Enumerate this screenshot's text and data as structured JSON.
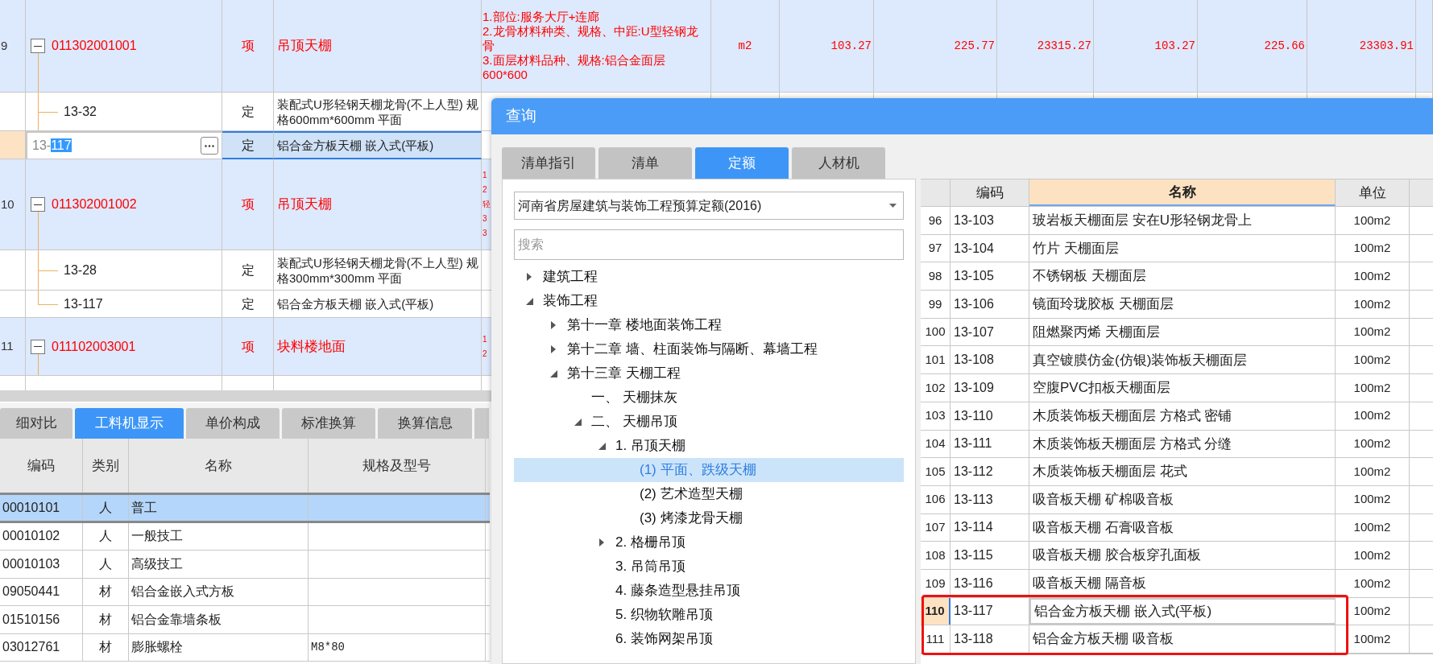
{
  "main_table": {
    "rows": [
      {
        "kind": "item",
        "number": "9",
        "code": "011302001001",
        "expanded": true,
        "type": "项",
        "name": "吊顶天棚",
        "features": [
          "1.部位:服务大厅+连廊",
          "2.龙骨材料种类、规格、中距:U型轻钢龙骨",
          "3.面层材料品种、规格:铝合金面层600*600"
        ],
        "unit": "m2",
        "values": [
          "103.27",
          "225.77",
          "23315.27",
          "103.27",
          "225.66",
          "23303.91"
        ],
        "selected": false
      },
      {
        "kind": "quota",
        "code": "13-32",
        "type": "定",
        "name": "装配式U形轻钢天棚龙骨(不上人型) 规格600mm*600mm 平面",
        "selected": false
      },
      {
        "kind": "editor",
        "code_before": "13-",
        "code_selected": "117",
        "type": "定",
        "name": "铝合金方板天棚 嵌入式(平板)",
        "selected": true
      },
      {
        "kind": "item",
        "number": "10",
        "code": "011302001002",
        "expanded": true,
        "type": "项",
        "name": "吊顶天棚",
        "features": [
          "1",
          "2",
          "轻",
          "3",
          "3"
        ],
        "selected": false
      },
      {
        "kind": "quota",
        "code": "13-28",
        "type": "定",
        "name": "装配式U形轻钢天棚龙骨(不上人型) 规格300mm*300mm 平面",
        "selected": false
      },
      {
        "kind": "quota",
        "code": "13-117",
        "type": "定",
        "name": "铝合金方板天棚 嵌入式(平板)",
        "selected": false
      },
      {
        "kind": "item",
        "number": "11",
        "code": "011102003001",
        "expanded": true,
        "type": "项",
        "name": "块料楼地面",
        "features": [
          "1",
          "2"
        ],
        "selected": false
      }
    ]
  },
  "bottom_panel": {
    "tabs": [
      {
        "label": "细对比",
        "selected": false
      },
      {
        "label": "工料机显示",
        "selected": true
      },
      {
        "label": "单价构成",
        "selected": false
      },
      {
        "label": "标准换算",
        "selected": false
      },
      {
        "label": "换算信息",
        "selected": false
      }
    ],
    "columns": [
      "编码",
      "类别",
      "名称",
      "规格及型号"
    ],
    "rows": [
      {
        "cells": [
          "00010101",
          "人",
          "普工",
          ""
        ],
        "selected": true
      },
      {
        "cells": [
          "00010102",
          "人",
          "一般技工",
          ""
        ],
        "selected": false
      },
      {
        "cells": [
          "00010103",
          "人",
          "高级技工",
          ""
        ],
        "selected": false
      },
      {
        "cells": [
          "09050441",
          "材",
          "铝合金嵌入式方板",
          ""
        ],
        "selected": false
      },
      {
        "cells": [
          "01510156",
          "材",
          "铝合金靠墙条板",
          ""
        ],
        "selected": false
      },
      {
        "cells": [
          "03012761",
          "材",
          "膨胀螺栓",
          "M8*80"
        ],
        "selected": false
      }
    ]
  },
  "dialog": {
    "title": "查询",
    "tabs": [
      {
        "label": "清单指引",
        "selected": false
      },
      {
        "label": "清单",
        "selected": false
      },
      {
        "label": "定额",
        "selected": true
      },
      {
        "label": "人材机",
        "selected": false
      }
    ],
    "library": "河南省房屋建筑与装饰工程预算定额(2016)",
    "search": {
      "placeholder": "搜索"
    },
    "tree": [
      {
        "label": "建筑工程",
        "expanded": false,
        "selected": false
      },
      {
        "label": "装饰工程",
        "expanded": true,
        "selected": false,
        "children": [
          {
            "label": "第十一章 楼地面装饰工程",
            "expanded": false,
            "selected": false
          },
          {
            "label": "第十二章 墙、柱面装饰与隔断、幕墙工程",
            "expanded": false,
            "selected": false
          },
          {
            "label": "第十三章 天棚工程",
            "expanded": true,
            "selected": false,
            "children": [
              {
                "label": "一、 天棚抹灰",
                "selected": false
              },
              {
                "label": "二、 天棚吊顶",
                "expanded": true,
                "selected": false,
                "children": [
                  {
                    "label": "1. 吊顶天棚",
                    "expanded": true,
                    "selected": false,
                    "children": [
                      {
                        "label": "(1) 平面、跌级天棚",
                        "selected": true
                      },
                      {
                        "label": "(2) 艺术造型天棚",
                        "selected": false
                      },
                      {
                        "label": "(3) 烤漆龙骨天棚",
                        "selected": false
                      }
                    ]
                  },
                  {
                    "label": "2. 格栅吊顶",
                    "expanded": false,
                    "selected": false
                  },
                  {
                    "label": "3. 吊筒吊顶",
                    "selected": false
                  },
                  {
                    "label": "4. 藤条造型悬挂吊顶",
                    "selected": false
                  },
                  {
                    "label": "5. 织物软雕吊顶",
                    "selected": false
                  },
                  {
                    "label": "6. 装饰网架吊顶",
                    "selected": false
                  }
                ]
              }
            ]
          }
        ]
      }
    ],
    "quota_table": {
      "columns": [
        {
          "label": "编码",
          "highlighted": false
        },
        {
          "label": "名称",
          "highlighted": true
        },
        {
          "label": "单位",
          "highlighted": false
        }
      ],
      "rows": [
        {
          "number": "96",
          "code": "13-103",
          "name": "玻岩板天棚面层 安在U形轻钢龙骨上",
          "unit": "100m2",
          "selected": false,
          "boxed": false
        },
        {
          "number": "97",
          "code": "13-104",
          "name": "竹片 天棚面层",
          "unit": "100m2",
          "selected": false,
          "boxed": false
        },
        {
          "number": "98",
          "code": "13-105",
          "name": "不锈钢板 天棚面层",
          "unit": "100m2",
          "selected": false,
          "boxed": false
        },
        {
          "number": "99",
          "code": "13-106",
          "name": "镜面玲珑胶板 天棚面层",
          "unit": "100m2",
          "selected": false,
          "boxed": false
        },
        {
          "number": "100",
          "code": "13-107",
          "name": "阻燃聚丙烯 天棚面层",
          "unit": "100m2",
          "selected": false,
          "boxed": false
        },
        {
          "number": "101",
          "code": "13-108",
          "name": "真空镀膜仿金(仿银)装饰板天棚面层",
          "unit": "100m2",
          "selected": false,
          "boxed": false
        },
        {
          "number": "102",
          "code": "13-109",
          "name": "空腹PVC扣板天棚面层",
          "unit": "100m2",
          "selected": false,
          "boxed": false
        },
        {
          "number": "103",
          "code": "13-110",
          "name": "木质装饰板天棚面层 方格式 密铺",
          "unit": "100m2",
          "selected": false,
          "boxed": false
        },
        {
          "number": "104",
          "code": "13-111",
          "name": "木质装饰板天棚面层 方格式 分缝",
          "unit": "100m2",
          "selected": false,
          "boxed": false
        },
        {
          "number": "105",
          "code": "13-112",
          "name": "木质装饰板天棚面层 花式",
          "unit": "100m2",
          "selected": false,
          "boxed": false
        },
        {
          "number": "106",
          "code": "13-113",
          "name": "吸音板天棚 矿棉吸音板",
          "unit": "100m2",
          "selected": false,
          "boxed": false
        },
        {
          "number": "107",
          "code": "13-114",
          "name": "吸音板天棚 石膏吸音板",
          "unit": "100m2",
          "selected": false,
          "boxed": false
        },
        {
          "number": "108",
          "code": "13-115",
          "name": "吸音板天棚 胶合板穿孔面板",
          "unit": "100m2",
          "selected": false,
          "boxed": false
        },
        {
          "number": "109",
          "code": "13-116",
          "name": "吸音板天棚 隔音板",
          "unit": "100m2",
          "selected": false,
          "boxed": false
        },
        {
          "number": "110",
          "code": "13-117",
          "name": "铝合金方板天棚 嵌入式(平板)",
          "unit": "100m2",
          "selected": true,
          "boxed": true
        },
        {
          "number": "111",
          "code": "13-118",
          "name": "铝合金方板天棚 吸音板",
          "unit": "100m2",
          "selected": false,
          "boxed": true
        }
      ]
    }
  }
}
